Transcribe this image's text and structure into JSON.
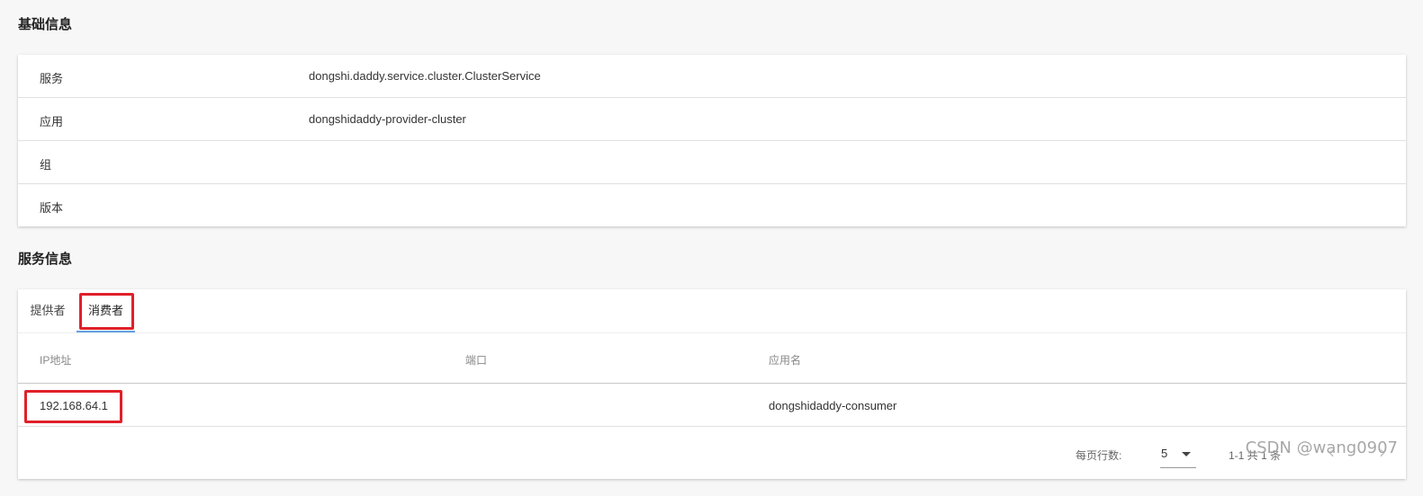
{
  "basic_info": {
    "title": "基础信息",
    "rows": [
      {
        "key": "服务",
        "value": "dongshi.daddy.service.cluster.ClusterService"
      },
      {
        "key": "应用",
        "value": "dongshidaddy-provider-cluster"
      },
      {
        "key": "组",
        "value": ""
      },
      {
        "key": "版本",
        "value": ""
      }
    ]
  },
  "service_info": {
    "title": "服务信息",
    "tabs": [
      {
        "label": "提供者",
        "active": false
      },
      {
        "label": "消费者",
        "active": true
      }
    ],
    "table": {
      "columns": [
        "IP地址",
        "端口",
        "应用名"
      ],
      "rows": [
        {
          "ip": "192.168.64.1",
          "port": "",
          "app": "dongshidaddy-consumer"
        }
      ]
    },
    "pagination": {
      "rows_per_page_label": "每页行数:",
      "rows_per_page": "5",
      "range_text": "1-1 共 1 条",
      "prev_icon": "‹",
      "next_icon": "›"
    }
  },
  "highlight_color": "#e0202a",
  "tab_indicator_color": "#64a0e6",
  "watermark": "CSDN @wang0907"
}
